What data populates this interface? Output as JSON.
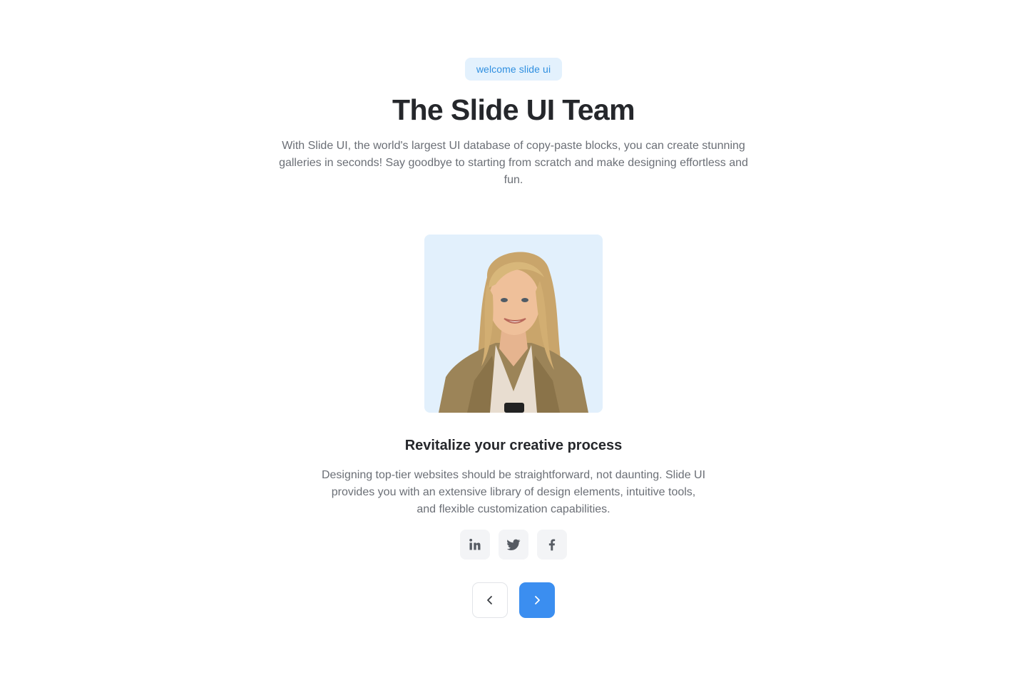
{
  "header": {
    "badge": "welcome slide ui",
    "title": "The Slide UI Team",
    "intro": "With Slide UI, the world's largest UI database of copy-paste blocks, you can create stunning galleries in seconds! Say goodbye to starting from scratch and make designing effortless and fun."
  },
  "slide": {
    "photo_alt": "team-member-photo",
    "heading": "Revitalize your creative process",
    "description": "Designing top-tier websites should be straightforward, not daunting. Slide UI provides you with an extensive library of design elements, intuitive tools, and flexible customization capabilities."
  },
  "socials": [
    {
      "icon": "linkedin-icon"
    },
    {
      "icon": "twitter-icon"
    },
    {
      "icon": "facebook-icon"
    }
  ],
  "navigation": {
    "prev_icon": "chevron-left-icon",
    "next_icon": "chevron-right-icon"
  },
  "colors": {
    "accent": "#3b8ef0",
    "badge_bg": "#e3f1fd",
    "badge_text": "#2f8fe0",
    "photo_bg": "#e2f0fc",
    "social_bg": "#f3f4f6"
  }
}
